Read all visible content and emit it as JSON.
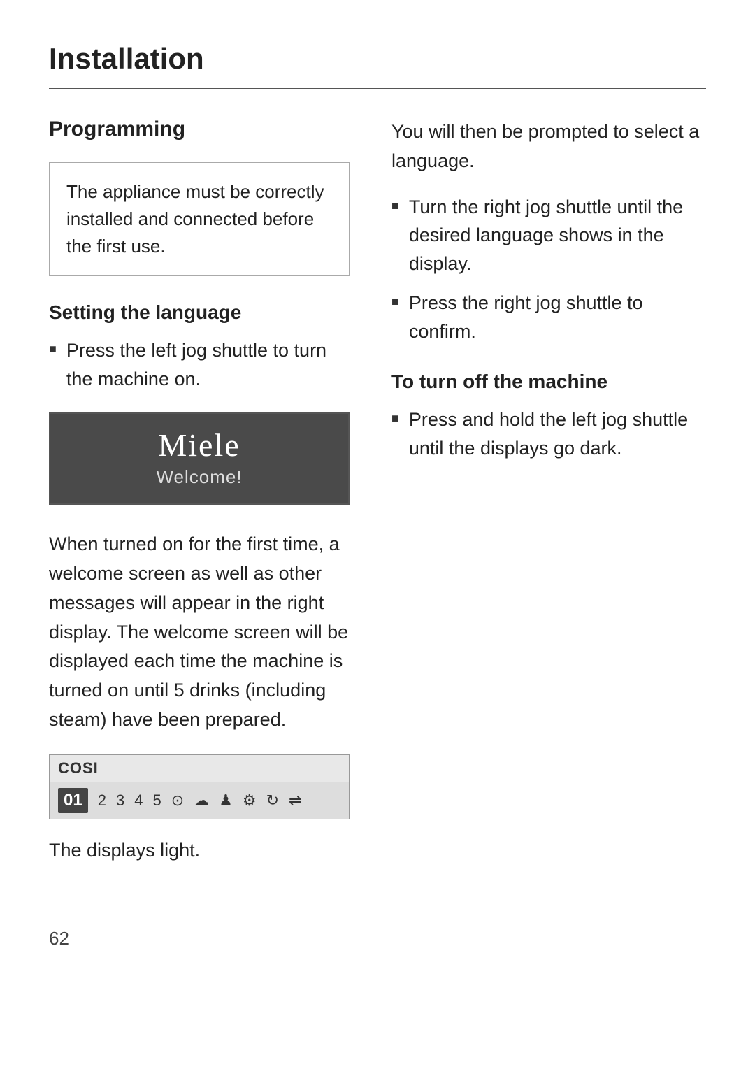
{
  "page": {
    "title": "Installation",
    "page_number": "62"
  },
  "left_column": {
    "section_title": "Programming",
    "notice_box": {
      "text": "The appliance must be correctly installed and connected before the first use."
    },
    "setting_language": {
      "subtitle": "Setting the language",
      "bullet1": "Press the left jog shuttle to turn the machine on."
    },
    "display_screen": {
      "brand": "Miele",
      "welcome": "Welcome!"
    },
    "body_text": "When turned on for the first time, a welcome screen as well as other messages will appear in the right display. The welcome screen will be displayed each time the machine is turned on until 5 drinks (including steam) have been prepared.",
    "cosi_display": {
      "top_label": "COSI",
      "active_item": "01",
      "items": [
        "2",
        "3",
        "4",
        "5"
      ]
    },
    "displays_light": "The displays light."
  },
  "right_column": {
    "intro_text": "You will then be prompted to select a language.",
    "bullet1": "Turn the right jog shuttle until the desired language shows in the display.",
    "bullet2": "Press the right jog shuttle to confirm.",
    "turn_off": {
      "subtitle": "To turn off the machine",
      "bullet1": "Press and hold the left jog shuttle until the displays go dark."
    }
  }
}
